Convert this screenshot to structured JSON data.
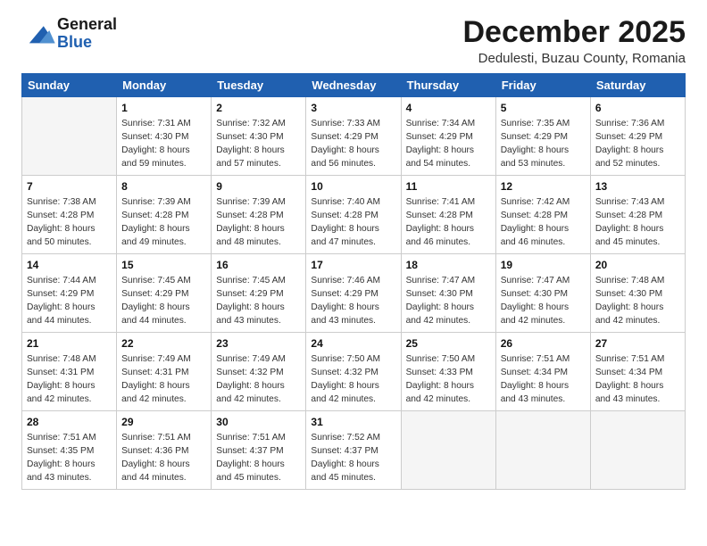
{
  "logo": {
    "general": "General",
    "blue": "Blue"
  },
  "title": "December 2025",
  "subtitle": "Dedulesti, Buzau County, Romania",
  "days_of_week": [
    "Sunday",
    "Monday",
    "Tuesday",
    "Wednesday",
    "Thursday",
    "Friday",
    "Saturday"
  ],
  "weeks": [
    [
      {
        "day": "",
        "info": ""
      },
      {
        "day": "1",
        "info": "Sunrise: 7:31 AM\nSunset: 4:30 PM\nDaylight: 8 hours\nand 59 minutes."
      },
      {
        "day": "2",
        "info": "Sunrise: 7:32 AM\nSunset: 4:30 PM\nDaylight: 8 hours\nand 57 minutes."
      },
      {
        "day": "3",
        "info": "Sunrise: 7:33 AM\nSunset: 4:29 PM\nDaylight: 8 hours\nand 56 minutes."
      },
      {
        "day": "4",
        "info": "Sunrise: 7:34 AM\nSunset: 4:29 PM\nDaylight: 8 hours\nand 54 minutes."
      },
      {
        "day": "5",
        "info": "Sunrise: 7:35 AM\nSunset: 4:29 PM\nDaylight: 8 hours\nand 53 minutes."
      },
      {
        "day": "6",
        "info": "Sunrise: 7:36 AM\nSunset: 4:29 PM\nDaylight: 8 hours\nand 52 minutes."
      }
    ],
    [
      {
        "day": "7",
        "info": "Sunrise: 7:38 AM\nSunset: 4:28 PM\nDaylight: 8 hours\nand 50 minutes."
      },
      {
        "day": "8",
        "info": "Sunrise: 7:39 AM\nSunset: 4:28 PM\nDaylight: 8 hours\nand 49 minutes."
      },
      {
        "day": "9",
        "info": "Sunrise: 7:39 AM\nSunset: 4:28 PM\nDaylight: 8 hours\nand 48 minutes."
      },
      {
        "day": "10",
        "info": "Sunrise: 7:40 AM\nSunset: 4:28 PM\nDaylight: 8 hours\nand 47 minutes."
      },
      {
        "day": "11",
        "info": "Sunrise: 7:41 AM\nSunset: 4:28 PM\nDaylight: 8 hours\nand 46 minutes."
      },
      {
        "day": "12",
        "info": "Sunrise: 7:42 AM\nSunset: 4:28 PM\nDaylight: 8 hours\nand 46 minutes."
      },
      {
        "day": "13",
        "info": "Sunrise: 7:43 AM\nSunset: 4:28 PM\nDaylight: 8 hours\nand 45 minutes."
      }
    ],
    [
      {
        "day": "14",
        "info": "Sunrise: 7:44 AM\nSunset: 4:29 PM\nDaylight: 8 hours\nand 44 minutes."
      },
      {
        "day": "15",
        "info": "Sunrise: 7:45 AM\nSunset: 4:29 PM\nDaylight: 8 hours\nand 44 minutes."
      },
      {
        "day": "16",
        "info": "Sunrise: 7:45 AM\nSunset: 4:29 PM\nDaylight: 8 hours\nand 43 minutes."
      },
      {
        "day": "17",
        "info": "Sunrise: 7:46 AM\nSunset: 4:29 PM\nDaylight: 8 hours\nand 43 minutes."
      },
      {
        "day": "18",
        "info": "Sunrise: 7:47 AM\nSunset: 4:30 PM\nDaylight: 8 hours\nand 42 minutes."
      },
      {
        "day": "19",
        "info": "Sunrise: 7:47 AM\nSunset: 4:30 PM\nDaylight: 8 hours\nand 42 minutes."
      },
      {
        "day": "20",
        "info": "Sunrise: 7:48 AM\nSunset: 4:30 PM\nDaylight: 8 hours\nand 42 minutes."
      }
    ],
    [
      {
        "day": "21",
        "info": "Sunrise: 7:48 AM\nSunset: 4:31 PM\nDaylight: 8 hours\nand 42 minutes."
      },
      {
        "day": "22",
        "info": "Sunrise: 7:49 AM\nSunset: 4:31 PM\nDaylight: 8 hours\nand 42 minutes."
      },
      {
        "day": "23",
        "info": "Sunrise: 7:49 AM\nSunset: 4:32 PM\nDaylight: 8 hours\nand 42 minutes."
      },
      {
        "day": "24",
        "info": "Sunrise: 7:50 AM\nSunset: 4:32 PM\nDaylight: 8 hours\nand 42 minutes."
      },
      {
        "day": "25",
        "info": "Sunrise: 7:50 AM\nSunset: 4:33 PM\nDaylight: 8 hours\nand 42 minutes."
      },
      {
        "day": "26",
        "info": "Sunrise: 7:51 AM\nSunset: 4:34 PM\nDaylight: 8 hours\nand 43 minutes."
      },
      {
        "day": "27",
        "info": "Sunrise: 7:51 AM\nSunset: 4:34 PM\nDaylight: 8 hours\nand 43 minutes."
      }
    ],
    [
      {
        "day": "28",
        "info": "Sunrise: 7:51 AM\nSunset: 4:35 PM\nDaylight: 8 hours\nand 43 minutes."
      },
      {
        "day": "29",
        "info": "Sunrise: 7:51 AM\nSunset: 4:36 PM\nDaylight: 8 hours\nand 44 minutes."
      },
      {
        "day": "30",
        "info": "Sunrise: 7:51 AM\nSunset: 4:37 PM\nDaylight: 8 hours\nand 45 minutes."
      },
      {
        "day": "31",
        "info": "Sunrise: 7:52 AM\nSunset: 4:37 PM\nDaylight: 8 hours\nand 45 minutes."
      },
      {
        "day": "",
        "info": ""
      },
      {
        "day": "",
        "info": ""
      },
      {
        "day": "",
        "info": ""
      }
    ]
  ]
}
